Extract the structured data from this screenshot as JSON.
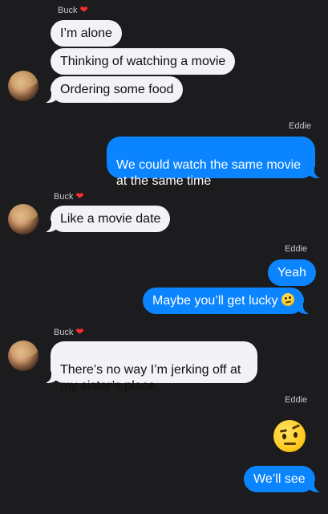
{
  "conversation": {
    "contact_name": "Buck",
    "me_name": "Eddie",
    "heart_icon": "heart-icon",
    "groups": [
      {
        "sender": "Buck",
        "messages": [
          "I’m alone",
          "Thinking of watching a movie",
          "Ordering some food"
        ]
      },
      {
        "sender": "Eddie",
        "messages": [
          "We could watch the same movie\nat the same time"
        ]
      },
      {
        "sender": "Buck",
        "messages": [
          "Like a movie date"
        ]
      },
      {
        "sender": "Eddie",
        "messages": [
          "Yeah",
          "Maybe you’ll get lucky"
        ]
      },
      {
        "sender": "Buck",
        "messages": [
          "There’s no way I’m jerking off at\nmy sister’s place."
        ]
      },
      {
        "sender": "Eddie",
        "messages": [
          "We’ll see"
        ]
      }
    ],
    "emojis": {
      "smirk": "smirking-face-emoji",
      "raised_eyebrow": "face-with-raised-eyebrow-emoji"
    }
  },
  "colors": {
    "background": "#1c1c1e",
    "incoming_bubble": "#f2f2f7",
    "outgoing_bubble": "#0a84ff",
    "heart": "#ff2d2d"
  }
}
